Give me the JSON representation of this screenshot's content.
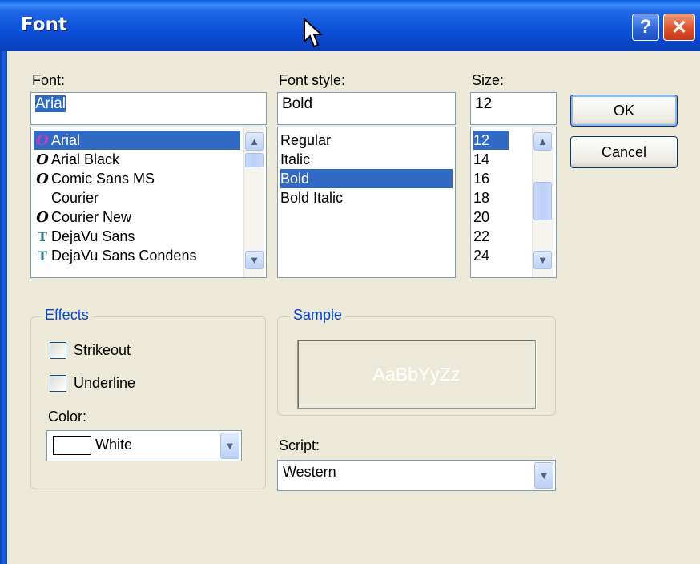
{
  "window": {
    "title": "Font"
  },
  "titlebar": {
    "help_label": "?",
    "close_label": "✕"
  },
  "font": {
    "label": "Font:",
    "value": "Arial",
    "items": [
      {
        "icon": "O",
        "icon_type": "opentype",
        "label": "Arial",
        "selected": true
      },
      {
        "icon": "O",
        "icon_type": "opentype",
        "label": "Arial Black"
      },
      {
        "icon": "O",
        "icon_type": "opentype",
        "label": "Comic Sans MS"
      },
      {
        "icon": "",
        "icon_type": "none",
        "label": "Courier"
      },
      {
        "icon": "O",
        "icon_type": "opentype",
        "label": "Courier New"
      },
      {
        "icon": "T",
        "icon_type": "truetype",
        "label": "DejaVu Sans"
      },
      {
        "icon": "T",
        "icon_type": "truetype",
        "label": "DejaVu Sans Condens"
      }
    ]
  },
  "style": {
    "label": "Font style:",
    "value": "Bold",
    "items": [
      "Regular",
      "Italic",
      "Bold",
      "Bold Italic"
    ],
    "selected_index": 2
  },
  "size": {
    "label": "Size:",
    "value": "12",
    "items": [
      "12",
      "14",
      "16",
      "18",
      "20",
      "22",
      "24"
    ],
    "selected_index": 0
  },
  "buttons": {
    "ok": "OK",
    "cancel": "Cancel"
  },
  "effects": {
    "legend": "Effects",
    "strikeout": "Strikeout",
    "underline": "Underline",
    "color_label": "Color:",
    "color_value": "White",
    "color_swatch": "#ffffff"
  },
  "sample": {
    "legend": "Sample",
    "text": "AaBbYyZz"
  },
  "script": {
    "label": "Script:",
    "value": "Western"
  },
  "colors": {
    "selection": "#316ac5",
    "titlebar": "#0a4fd6",
    "dialog_bg": "#ece9d8",
    "legend_text": "#0046d5"
  }
}
